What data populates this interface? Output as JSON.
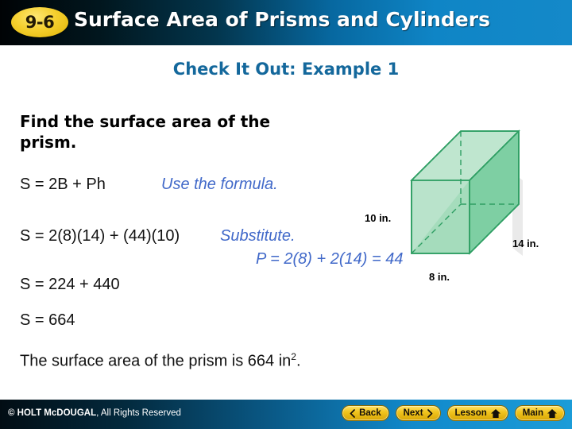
{
  "header": {
    "lesson_number": "9-6",
    "title": "Surface Area of Prisms and Cylinders"
  },
  "slide": {
    "example_heading": "Check It Out: Example 1",
    "prompt": "Find the surface area of the prism.",
    "steps": [
      {
        "equation": "S = 2B + Ph",
        "note": "Use the formula."
      },
      {
        "equation": "S = 2(8)(14) + (44)(10)",
        "note": "Substitute.",
        "note_b": "P = 2(8) + 2(14) = 44"
      },
      {
        "equation": "S = 224 + 440",
        "note": ""
      },
      {
        "equation": "S = 664",
        "note": ""
      }
    ],
    "conclusion_prefix": "The surface area of the prism is 664 in",
    "conclusion_exponent": "2",
    "conclusion_suffix": "."
  },
  "figure": {
    "name": "rectangular-prism",
    "height_label": "10 in.",
    "depth_label": "14 in.",
    "width_label": "8 in.",
    "face_fill_front": "#a9ddc0",
    "face_fill_side": "#7ecfa3",
    "face_fill_top": "#bfe6cf",
    "edge_color": "#2e9e63"
  },
  "footer": {
    "copyright_strong": "© HOLT McDOUGAL",
    "copyright_rest": ", All Rights Reserved",
    "buttons": [
      {
        "label": "Back",
        "icon": "chevron-left-icon"
      },
      {
        "label": "Next",
        "icon": "chevron-right-icon"
      },
      {
        "label": "Lesson",
        "icon": "home-icon"
      },
      {
        "label": "Main",
        "icon": "home-icon"
      }
    ]
  },
  "colors": {
    "header_dark": "#000305",
    "header_blue": "#1489c9",
    "badge_gold": "#f0c41e",
    "heading_blue": "#14689c",
    "annotation_blue": "#4169c9"
  }
}
